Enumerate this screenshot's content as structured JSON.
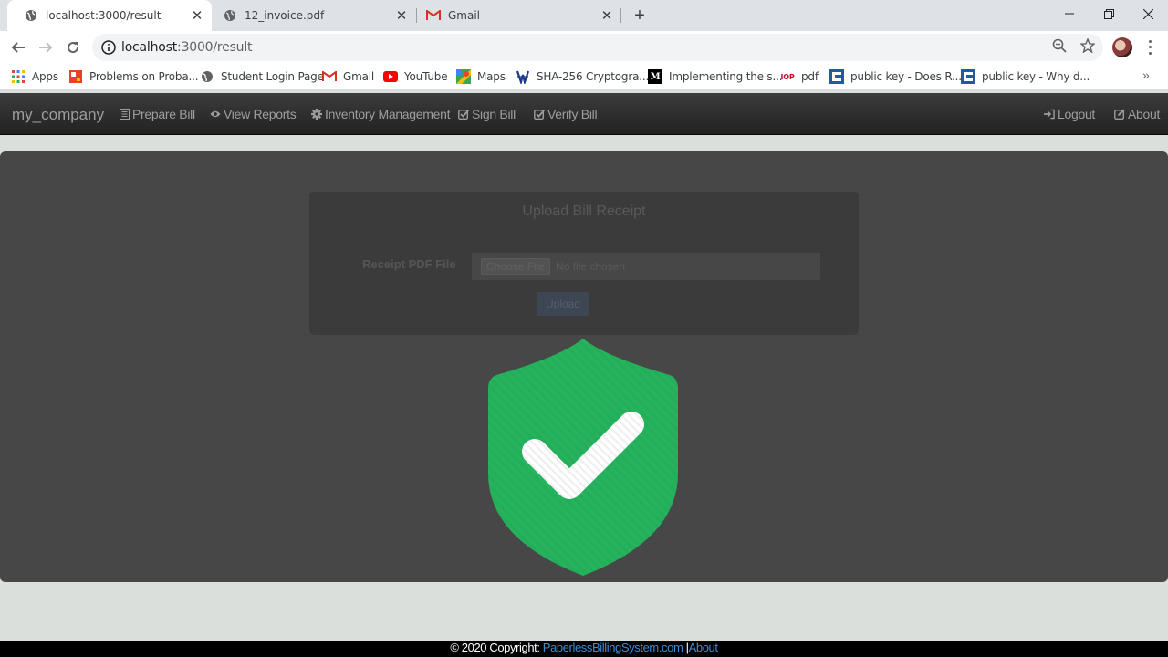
{
  "browser": {
    "tabs": [
      {
        "title": "localhost:3000/result",
        "active": true,
        "favicon": "globe-icon"
      },
      {
        "title": "12_invoice.pdf",
        "active": false,
        "favicon": "globe-icon"
      },
      {
        "title": "Gmail",
        "active": false,
        "favicon": "gmail-icon"
      }
    ],
    "url_host": "localhost",
    "url_rest": ":3000/result",
    "bookmarks": [
      {
        "label": "Apps",
        "icon": "apps-grid-icon"
      },
      {
        "label": "Problems on Proba...",
        "icon": "puzzle-icon"
      },
      {
        "label": "Student Login Page",
        "icon": "globe-icon"
      },
      {
        "label": "Gmail",
        "icon": "gmail-icon"
      },
      {
        "label": "YouTube",
        "icon": "youtube-icon"
      },
      {
        "label": "Maps",
        "icon": "maps-icon"
      },
      {
        "label": "SHA-256 Cryptogra...",
        "icon": "sha-icon"
      },
      {
        "label": "Implementing the s...",
        "icon": "medium-icon"
      },
      {
        "label": "pdf",
        "icon": "iop-icon"
      },
      {
        "label": "public key - Does R...",
        "icon": "stackexchange-icon"
      },
      {
        "label": "public key - Why d...",
        "icon": "stackexchange-icon"
      }
    ],
    "bookmarks_overflow": "»"
  },
  "navbar": {
    "brand": "my_company",
    "items": [
      {
        "label": "Prepare Bill",
        "icon": "list-icon"
      },
      {
        "label": "View Reports",
        "icon": "eye-icon"
      },
      {
        "label": "Inventory Management",
        "icon": "cog-icon"
      },
      {
        "label": "Sign Bill",
        "icon": "check-square-icon"
      },
      {
        "label": "Verify Bill",
        "icon": "check-square-icon"
      }
    ],
    "right_items": [
      {
        "label": "Logout",
        "icon": "log-in-icon"
      },
      {
        "label": "About",
        "icon": "edit-icon"
      }
    ]
  },
  "upload_card": {
    "title": "Upload Bill Receipt",
    "field_label": "Receipt PDF File",
    "choose_button": "Choose File",
    "no_file_text": "No file chosen",
    "submit_label": "Upload"
  },
  "result": {
    "icon": "shield-check-icon",
    "color": "#24ae5a"
  },
  "footer": {
    "prefix": "© 2020 Copyright:",
    "site_link": "PaperlessBillingSystem.com",
    "separator": "|",
    "about_link": "About"
  },
  "colors": {
    "navbar_bg": "#222222",
    "panel_bg": "#474747",
    "page_bg": "#dadfdb",
    "link": "#3a8ed8",
    "shield_green": "#24ae5a"
  }
}
